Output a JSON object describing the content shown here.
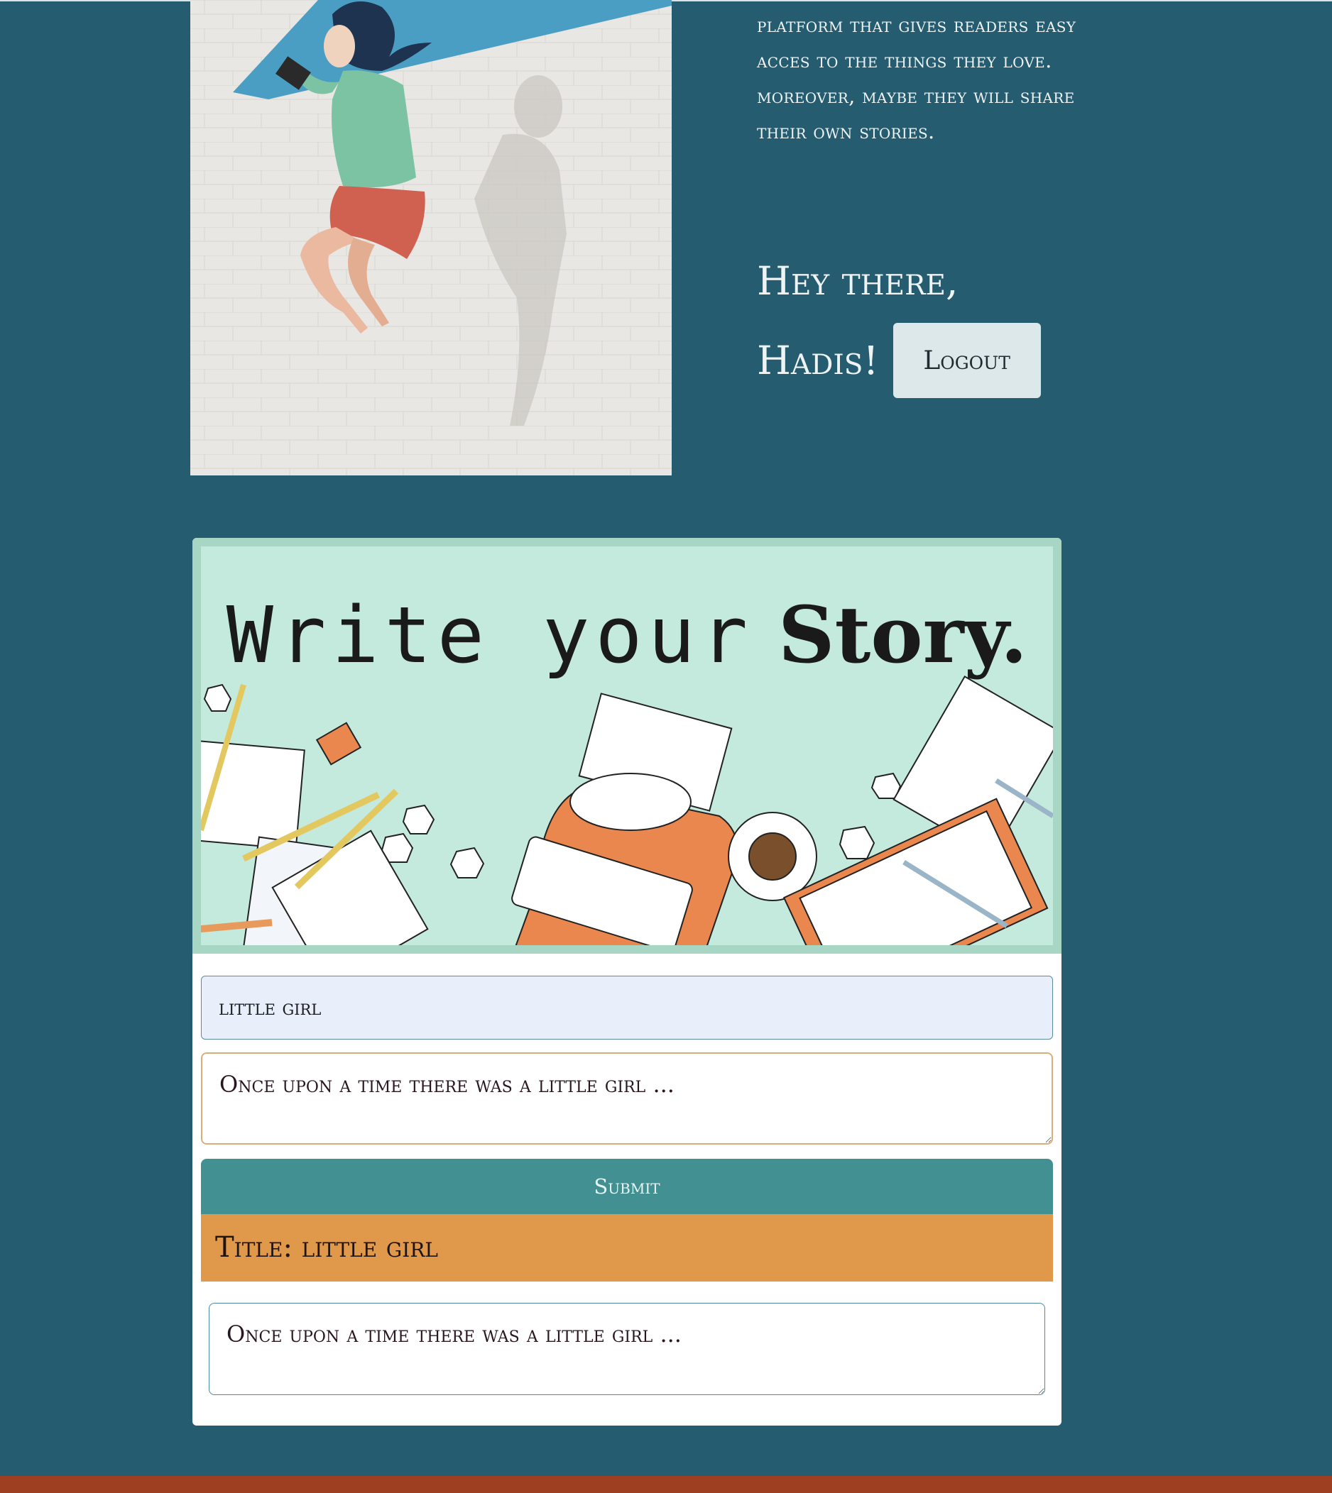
{
  "intro": {
    "text": "platform that gives readers easy acces to the things they love. moreover, maybe they will share their own stories."
  },
  "greeting": {
    "line1": "Hey there,",
    "name": "Hadis!"
  },
  "header": {
    "logout_label": "Logout"
  },
  "banner": {
    "title_word1": "Write your",
    "title_word2": "Story."
  },
  "form": {
    "title_value": "little girl",
    "story_value": "Once upon a time there was a little girl ...",
    "submit_label": "Submit"
  },
  "result": {
    "title": "Title: little girl",
    "body": "Once upon a time there was a little girl ..."
  },
  "colors": {
    "background": "#255c70",
    "submit": "#439092",
    "result_title": "#e0984a",
    "footer": "#9e3f22"
  }
}
